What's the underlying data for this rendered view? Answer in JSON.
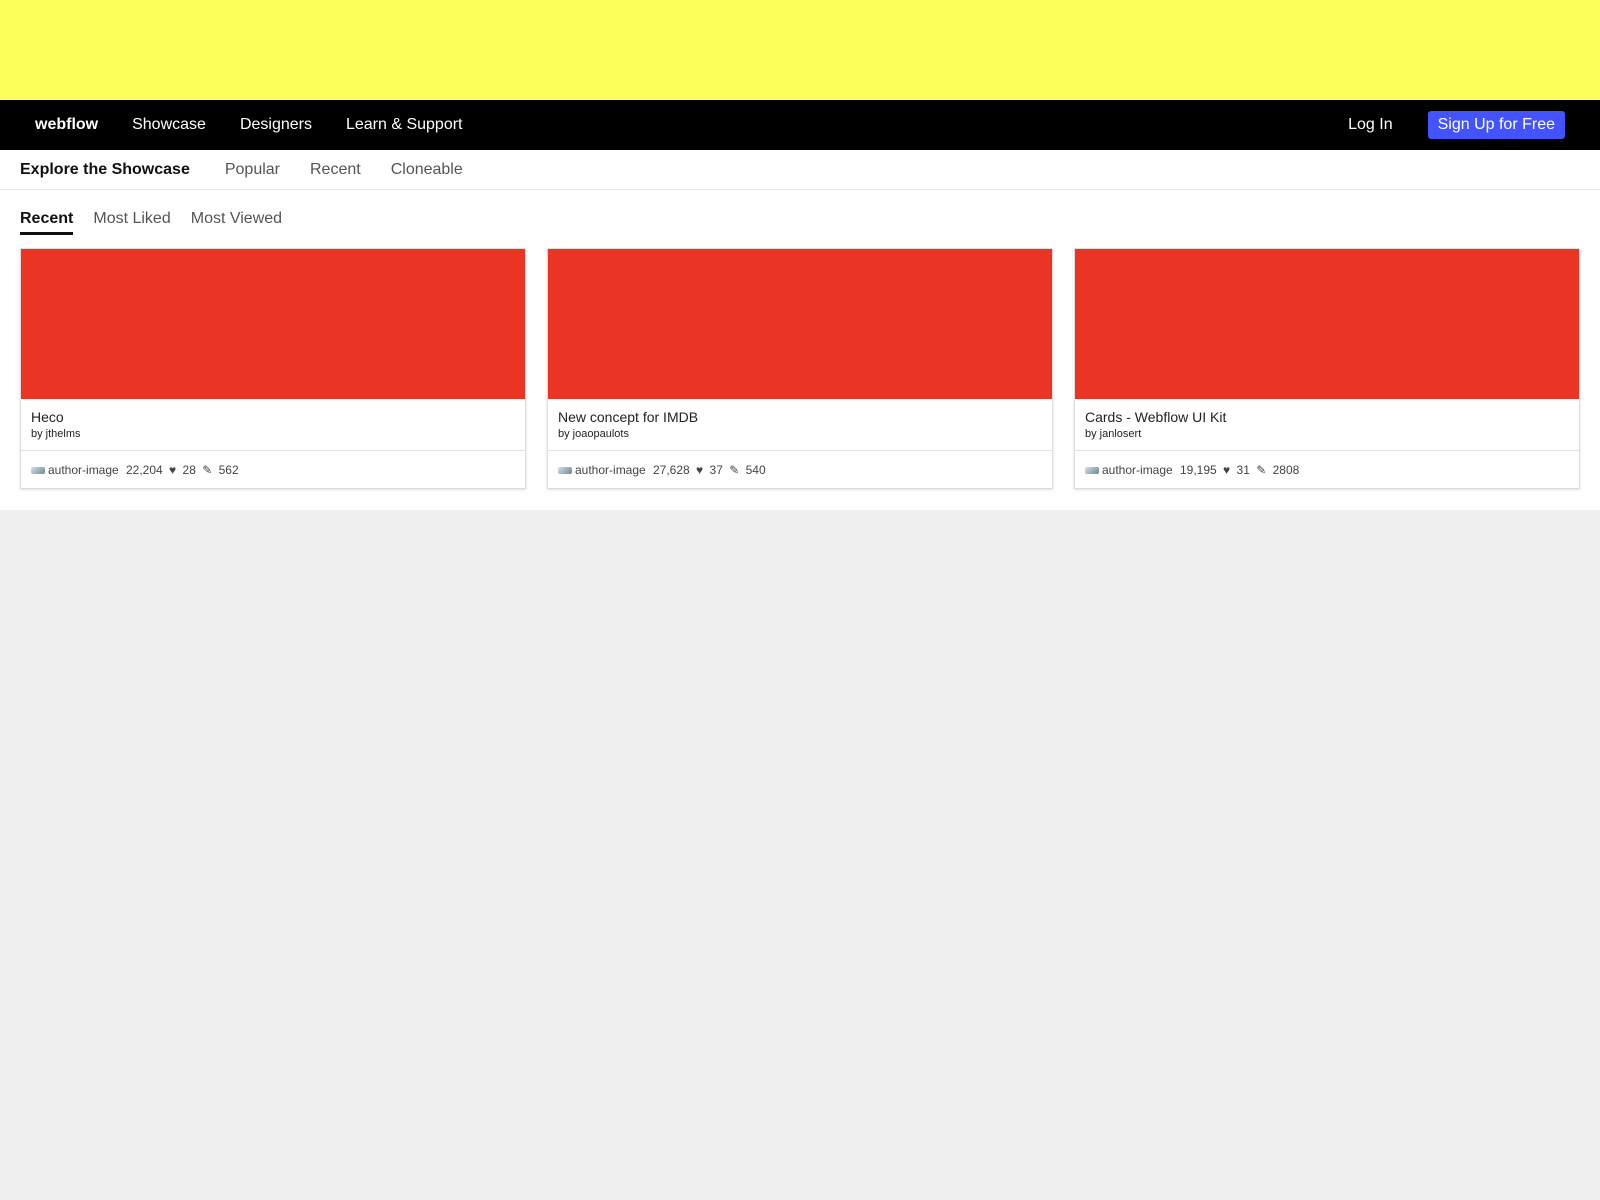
{
  "nav": {
    "brand": "webflow",
    "links": [
      "Showcase",
      "Designers",
      "Learn & Support"
    ],
    "login": "Log In",
    "signup": "Sign Up for Free"
  },
  "subnav": {
    "title": "Explore the Showcase",
    "links": [
      "Popular",
      "Recent",
      "Cloneable"
    ]
  },
  "tabs": {
    "items": [
      "Recent",
      "Most Liked",
      "Most Viewed"
    ],
    "active": "Recent"
  },
  "cards": [
    {
      "title": "Heco",
      "author": "by jthelms",
      "author_image_alt": "author-image",
      "views": "22,204",
      "likes": "28",
      "clones": "562"
    },
    {
      "title": "New concept for IMDB",
      "author": "by joaopaulots",
      "author_image_alt": "author-image",
      "views": "27,628",
      "likes": "37",
      "clones": "540"
    },
    {
      "title": "Cards - Webflow UI Kit",
      "author": "by janlosert",
      "author_image_alt": "author-image",
      "views": "19,195",
      "likes": "31",
      "clones": "2808"
    }
  ],
  "icons": {
    "like": "♥",
    "clone": "✎"
  },
  "colors": {
    "banner": "#ffff5b",
    "nav_bg": "#000000",
    "signup_bg": "#4353ff",
    "card_thumb": "#ea3424"
  }
}
